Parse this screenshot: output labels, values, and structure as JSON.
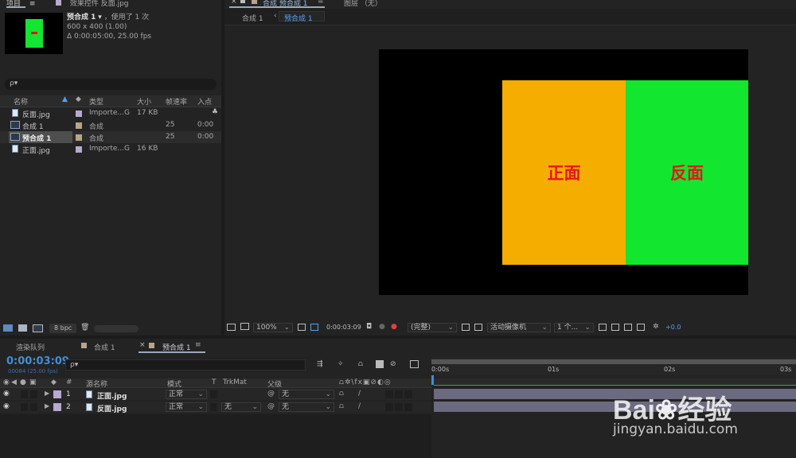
{
  "project": {
    "tabs": [
      {
        "label": "项目",
        "active": true
      },
      {
        "label": "效果控件 反面.jpg"
      }
    ],
    "selected_name": "预合成 1",
    "used_text": "，使用了 1 次",
    "dims_text": "600 x 400 (1.00)",
    "duration_text": "Δ 0:00:05:00, 25.00 fps",
    "search_placeholder": "ρ▾",
    "columns": [
      "名称",
      "类型",
      "大小",
      "帧速率",
      "入点"
    ],
    "rows": [
      {
        "name": "反面.jpg",
        "type": "Importe...G",
        "size": "17 KB",
        "fps": "",
        "in": "",
        "label_color": "#b7a9cf",
        "icon": "file-icon",
        "selected": false
      },
      {
        "name": "合成 1",
        "type": "合成",
        "size": "",
        "fps": "25",
        "in": "0:00",
        "label_color": "#b7a58b",
        "icon": "composition-icon",
        "selected": false
      },
      {
        "name": "预合成 1",
        "type": "合成",
        "size": "",
        "fps": "25",
        "in": "0:00",
        "label_color": "#b7a58b",
        "icon": "composition-icon",
        "selected": true
      },
      {
        "name": "正面.jpg",
        "type": "Importe...G",
        "size": "16 KB",
        "fps": "",
        "in": "",
        "label_color": "#b7a9cf",
        "icon": "file-icon",
        "selected": false
      }
    ],
    "bpc_label": "8 bpc"
  },
  "viewer": {
    "tab_label": "合成 预合成 1",
    "layer_tab_label": "图层 （无）",
    "breadcrumb": [
      "合成 1",
      "预合成 1"
    ],
    "front_text": "正面",
    "back_text": "反面",
    "colors": {
      "front_bg": "#f5ad00",
      "back_bg": "#12e62e",
      "text": "#e8141c",
      "canvas": "#000000"
    },
    "zoom": "100%",
    "timecode": "0:00:03:09",
    "resolution": "(完整)",
    "camera": "活动摄像机",
    "views": "1 个...",
    "exposure": "+0.0"
  },
  "timeline": {
    "tabs": [
      {
        "label": "渲染队列"
      },
      {
        "label": "合成 1"
      },
      {
        "label": "预合成 1",
        "active": true
      }
    ],
    "timecode": "0:00:03:09",
    "frame_info": "00084 (25.00 fps)",
    "search_placeholder": "ρ▾",
    "columns": {
      "num": "#",
      "source": "源名称",
      "mode": "模式",
      "t": "T",
      "trkmat": "TrkMat",
      "parent": "父级"
    },
    "layers": [
      {
        "num": "1",
        "name": "正面.jpg",
        "mode": "正常",
        "trkmat": "",
        "parent": "无"
      },
      {
        "num": "2",
        "name": "反面.jpg",
        "mode": "正常",
        "trkmat": "无",
        "parent": "无"
      }
    ],
    "ruler": [
      "0:00s",
      "01s",
      "02s",
      "03s"
    ]
  },
  "watermark": {
    "logo": "Bai du 经验",
    "url": "jingyan.baidu.com"
  }
}
